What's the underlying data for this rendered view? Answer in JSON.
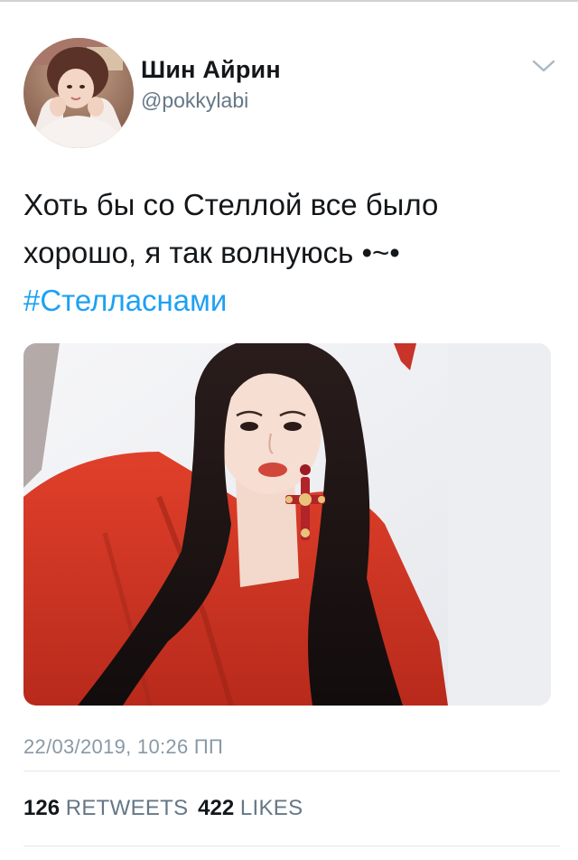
{
  "author": {
    "name": "Шин Айрин",
    "handle": "@pokkylabi"
  },
  "tweet": {
    "line1": "Хоть бы со Стеллой все было",
    "line2": "хорошо, я так волнуюсь •~•",
    "hashtag": "#Стелласнами"
  },
  "meta": {
    "timestamp": "22/03/2019, 10:26 ПП"
  },
  "stats": {
    "retweets_count": "126",
    "retweets_label": "RETWEETS",
    "likes_count": "422",
    "likes_label": "LIKES"
  },
  "colors": {
    "link": "#1da1f2",
    "secondary_text": "#657786",
    "timestamp_text": "#8899a6",
    "divider": "#e1e8ed"
  },
  "icons": {
    "menu": "chevron-down-icon"
  }
}
